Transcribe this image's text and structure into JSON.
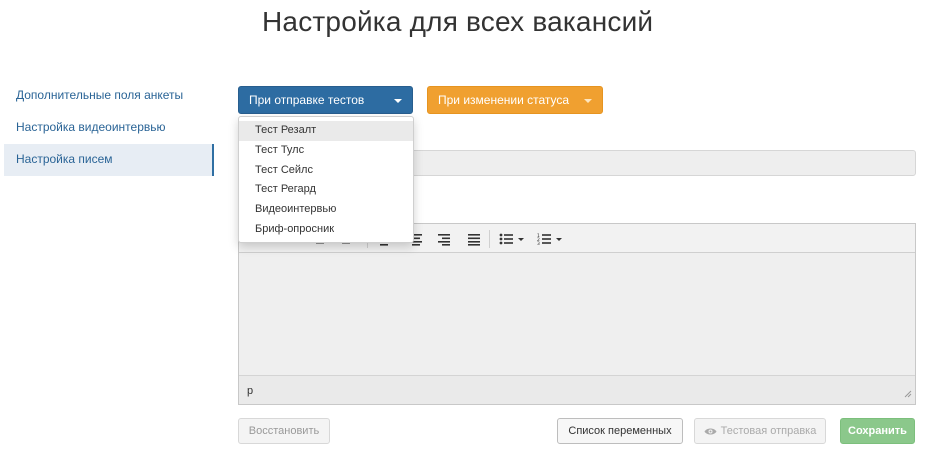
{
  "page": {
    "title": "Настройка для всех вакансий"
  },
  "sidebar": {
    "items": [
      {
        "label": "Дополнительные поля анкеты"
      },
      {
        "label": "Настройка видеоинтервью"
      },
      {
        "label": "Настройка писем",
        "active": true
      }
    ]
  },
  "dropdowns": {
    "tests_label": "При отправке тестов",
    "status_label": "При изменении статуса"
  },
  "dropdown_menu": {
    "items": [
      {
        "label": "Тест Резалт"
      },
      {
        "label": "Тест Тулс"
      },
      {
        "label": "Тест Сейлс"
      },
      {
        "label": "Тест Регард"
      },
      {
        "label": "Видеоинтервью"
      },
      {
        "label": "Бриф-опросник"
      }
    ]
  },
  "editor": {
    "status_path": "p",
    "toolbar_icons": [
      "bold-icon",
      "italic-icon",
      "align-left-icon",
      "align-center-icon",
      "align-right-icon",
      "align-justify-icon",
      "bullet-list-icon",
      "numbered-list-icon"
    ]
  },
  "buttons": {
    "restore": "Восстановить",
    "variables": "Список переменных",
    "test_send": "Тестовая отправка",
    "save": "Сохранить"
  },
  "colors": {
    "primary": "#2d6ca2",
    "warning": "#f0a030",
    "success": "#8bc88b"
  }
}
